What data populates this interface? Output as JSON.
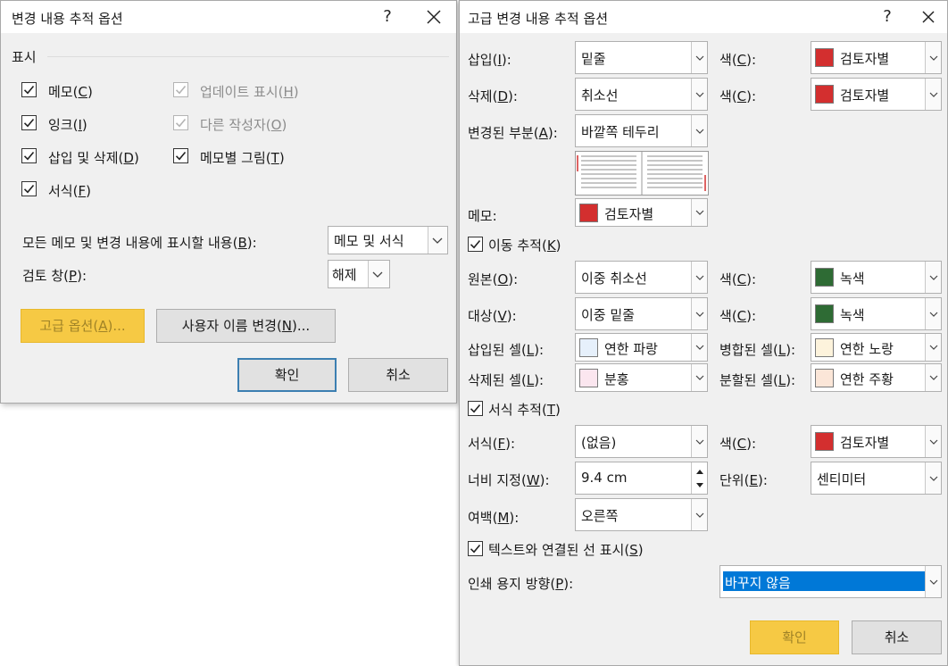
{
  "dialog1": {
    "title": "변경 내용 추적 옵션",
    "help_glyph": "?",
    "group_label": "표시",
    "checks": {
      "memo": {
        "text": "메모",
        "key": "C"
      },
      "ink": {
        "text": "잉크",
        "key": "I"
      },
      "insdel": {
        "text": "삽입 및 삭제",
        "key": "D"
      },
      "format": {
        "text": "서식",
        "key": "F"
      },
      "update": {
        "text": "업데이트 표시",
        "key": "H"
      },
      "other": {
        "text": "다른 작성자",
        "key": "O"
      },
      "pic": {
        "text": "메모별 그림",
        "key": "T"
      }
    },
    "show_label": {
      "text": "모든 메모 및 변경 내용에 표시할 내용",
      "key": "B",
      "suffix": ":"
    },
    "show_value": "메모 및 서식",
    "pane_label": {
      "text": "검토 창",
      "key": "P",
      "suffix": ":"
    },
    "pane_value": "해제",
    "advanced_btn": {
      "text": "고급 옵션",
      "key": "A",
      "suffix": "..."
    },
    "rename_btn": {
      "text": "사용자 이름 변경",
      "key": "N",
      "suffix": "..."
    },
    "ok": "확인",
    "cancel": "취소"
  },
  "dialog2": {
    "title": "고급 변경 내용 추적 옵션",
    "help_glyph": "?",
    "labels": {
      "insert": {
        "text": "삽입",
        "key": "I",
        "suffix": ":"
      },
      "delete": {
        "text": "삭제",
        "key": "D",
        "suffix": ":"
      },
      "changed": {
        "text": "변경된 부분",
        "key": "A",
        "suffix": ":"
      },
      "memo": {
        "text": "메모",
        "suffix": ":"
      },
      "move_track": {
        "text": "이동 추적",
        "key": "K"
      },
      "origin": {
        "text": "원본",
        "key": "O",
        "suffix": ":"
      },
      "target": {
        "text": "대상",
        "key": "V",
        "suffix": ":"
      },
      "ins_cell": {
        "text": "삽입된 셀",
        "key": "L",
        "suffix": ":"
      },
      "del_cell": {
        "text": "삭제된 셀",
        "key": "L",
        "suffix": ":"
      },
      "merged_cell": {
        "text": "병합된 셀",
        "key": "L",
        "suffix": ":"
      },
      "split_cell": {
        "text": "분할된 셀",
        "key": "L",
        "suffix": ":"
      },
      "fmt_track": {
        "text": "서식 추적",
        "key": "T"
      },
      "fmt": {
        "text": "서식",
        "key": "F",
        "suffix": ":"
      },
      "width": {
        "text": "너비 지정",
        "key": "W",
        "suffix": ":"
      },
      "unit": {
        "text": "단위",
        "key": "E",
        "suffix": ":"
      },
      "margin": {
        "text": "여백",
        "key": "M",
        "suffix": ":"
      },
      "lines": {
        "text": "텍스트와 연결된 선 표시",
        "key": "S"
      },
      "orient": {
        "text": "인쇄 용지 방향",
        "key": "P",
        "suffix": ":"
      },
      "color_ins": {
        "text": "색",
        "key": "C",
        "suffix": ":"
      },
      "color_del": {
        "text": "색",
        "key": "C",
        "suffix": ":"
      },
      "color_origin": {
        "text": "색",
        "key": "C",
        "suffix": ":"
      },
      "color_target": {
        "text": "색",
        "key": "C",
        "suffix": ":"
      },
      "color_fmt": {
        "text": "색",
        "key": "C",
        "suffix": ":"
      }
    },
    "values": {
      "insert": "밑줄",
      "delete": "취소선",
      "changed": "바깥쪽 테두리",
      "memo_color": "검토자별",
      "origin": "이중 취소선",
      "target": "이중 밑줄",
      "ins_cell": "연한 파랑",
      "del_cell": "분홍",
      "merged_cell": "연한 노랑",
      "split_cell": "연한 주황",
      "fmt": "(없음)",
      "width": "9.4 cm",
      "unit": "센티미터",
      "margin": "오른쪽",
      "orient": "바꾸지 않음",
      "color_ins": "검토자별",
      "color_del": "검토자별",
      "color_origin": "녹색",
      "color_target": "녹색",
      "color_fmt": "검토자별"
    },
    "ok": "확인",
    "cancel": "취소"
  },
  "colors": {
    "reviewer_red": "#d32f2f",
    "green": "#2e6b34",
    "light_blue": "#e6f0fb",
    "pink": "#fbe6ef",
    "light_yellow": "#fdf3dc",
    "light_orange": "#fbe6d8",
    "selection_blue": "#0078d7",
    "default_button_border": "#3c7fb1",
    "yellow_button": "#f6c944"
  }
}
